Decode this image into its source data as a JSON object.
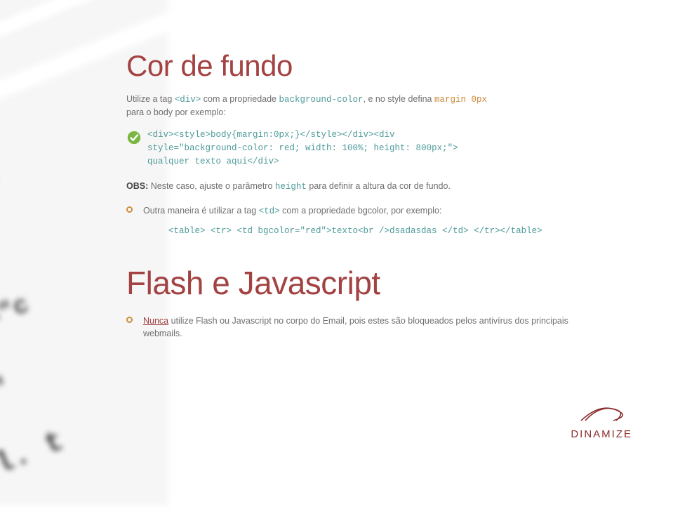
{
  "section1": {
    "title": "Cor de fundo",
    "intro_before": "Utilize a tag ",
    "intro_tag": "<div>",
    "intro_mid1": " com a propriedade ",
    "intro_prop": "background-color",
    "intro_mid2": ", e no style defina ",
    "intro_margin": "margin 0px",
    "intro_after": " para o body por exemplo:",
    "code1": "<div><style>body{margin:0px;}</style></div><div",
    "code2": "style=\"background-color: red; width: 100%; height: 800px;\">",
    "code3": "qualquer texto aqui</div>",
    "obs_label": "OBS:",
    "obs_before": " Neste caso, ajuste o parâmetro ",
    "obs_param": "height",
    "obs_after": " para definir a altura da cor de fundo.",
    "bullet_before": "Outra maneira é utilizar a tag ",
    "bullet_tag": "<td>",
    "bullet_after": " com a propriedade bgcolor, por exemplo:",
    "code_line": "<table> <tr>  <td bgcolor=\"red\">texto<br />dsadasdas </td> </tr></table>"
  },
  "section2": {
    "title": "Flash e Javascript",
    "nunca": "Nunca",
    "body": " utilize Flash ou Javascript no corpo do Email, pois estes são bloqueados pelos antivírus dos principais webmails."
  },
  "logo": "DINAMIZE"
}
